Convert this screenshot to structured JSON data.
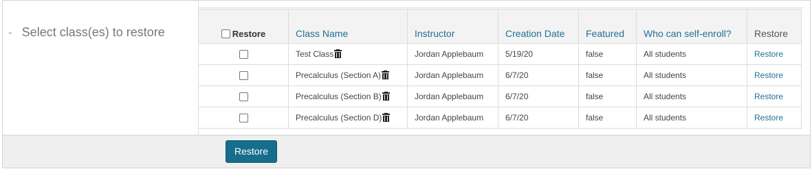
{
  "section": {
    "collapse_glyph": "-",
    "title": "Select class(es) to restore"
  },
  "table": {
    "headers": {
      "select_all": "Restore",
      "class_name": "Class Name",
      "instructor": "Instructor",
      "creation_date": "Creation Date",
      "featured": "Featured",
      "self_enroll": "Who can self-enroll?",
      "action": "Restore"
    },
    "rows": [
      {
        "class_name": "Test Class",
        "instructor": "Jordan Applebaum",
        "creation_date": "5/19/20",
        "featured": "false",
        "self_enroll": "All students",
        "action": "Restore",
        "checked": false
      },
      {
        "class_name": "Precalculus (Section A)",
        "instructor": "Jordan Applebaum",
        "creation_date": "6/7/20",
        "featured": "false",
        "self_enroll": "All students",
        "action": "Restore",
        "checked": false
      },
      {
        "class_name": "Precalculus (Section B)",
        "instructor": "Jordan Applebaum",
        "creation_date": "6/7/20",
        "featured": "false",
        "self_enroll": "All students",
        "action": "Restore",
        "checked": false
      },
      {
        "class_name": "Precalculus (Section D)",
        "instructor": "Jordan Applebaum",
        "creation_date": "6/7/20",
        "featured": "false",
        "self_enroll": "All students",
        "action": "Restore",
        "checked": false
      }
    ]
  },
  "footer": {
    "restore_button": "Restore"
  },
  "colors": {
    "link": "#1f6f93",
    "button": "#146e8c",
    "footer_bg": "#efefef"
  },
  "icons": {
    "row_delete": "trash-icon"
  }
}
